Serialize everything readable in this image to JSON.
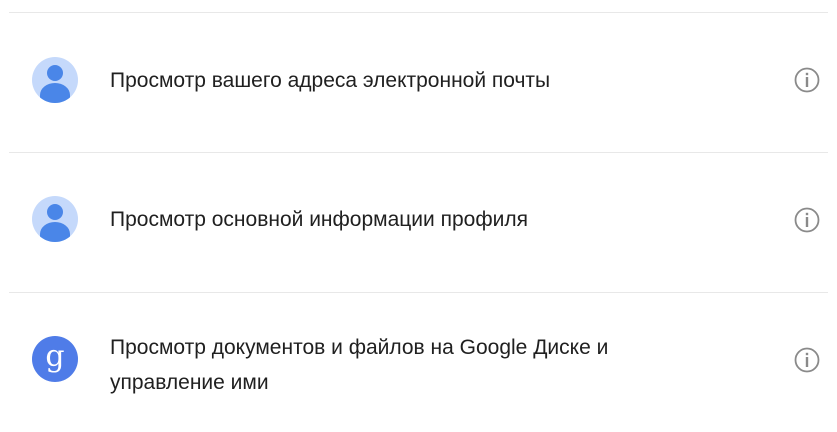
{
  "permissions": [
    {
      "icon": "person-avatar-icon",
      "text": "Просмотр вашего адреса электронной почты",
      "info_icon": "info-icon"
    },
    {
      "icon": "person-avatar-icon",
      "text": "Просмотр основной информации профиля",
      "info_icon": "info-icon"
    },
    {
      "icon": "google-drive-g-icon",
      "glyph": "g",
      "text_line1": "Просмотр документов и файлов на Google Диске и",
      "text_line2": "управление ими",
      "info_icon": "info-icon"
    }
  ],
  "colors": {
    "avatar_bg": "#c5d9fb",
    "avatar_fg": "#4a86e8",
    "g_icon_bg": "#4f7ce8",
    "text": "#202020",
    "divider": "#e8e8e8",
    "info_icon": "#8a8a8a"
  }
}
